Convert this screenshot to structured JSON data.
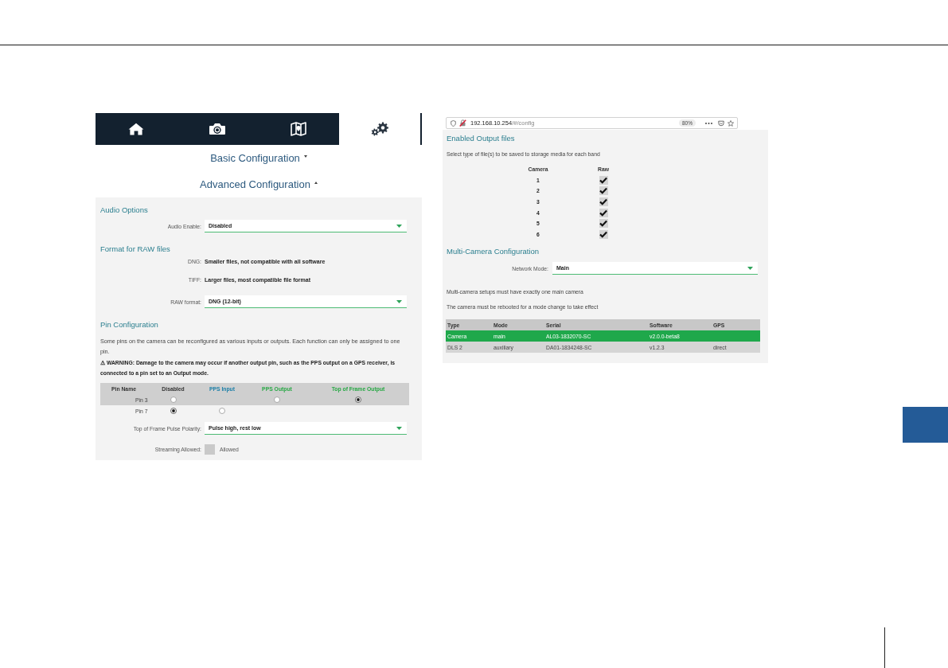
{
  "left_screen": {
    "nav_tabs": [
      {
        "kind": "home",
        "selected": false
      },
      {
        "kind": "camera",
        "selected": false
      },
      {
        "kind": "map",
        "selected": false
      },
      {
        "kind": "settings",
        "selected": true
      }
    ],
    "accordions": [
      {
        "title": "Basic Configuration",
        "expanded": false
      },
      {
        "title": "Advanced Configuration",
        "expanded": true
      }
    ],
    "sections": [
      {
        "heading": "Audio Options",
        "items": [
          {
            "kind": "select",
            "label": "Audio Enable:",
            "value": "Disabled"
          }
        ]
      },
      {
        "heading": "Format for RAW files",
        "items": [
          {
            "kind": "info",
            "label": "DNG:",
            "value": "Smaller files, not compatible with all software"
          },
          {
            "kind": "info",
            "label": "TIFF:",
            "value": "Larger files, most compatible file format"
          },
          {
            "kind": "select",
            "label": "RAW format:",
            "value": "DNG (12-bit)"
          }
        ]
      },
      {
        "heading": "Pin Configuration",
        "items": [
          {
            "kind": "paragraph",
            "text": "Some pins on the camera can be reconfigured as various inputs or outputs. Each function can only be assigned to one pin."
          },
          {
            "kind": "warning",
            "text": "⚠ WARNING: Damage to the camera may occur if another output pin, such as the PPS output on a GPS receiver, is connected to a pin set to an Output mode."
          },
          {
            "kind": "pin_table",
            "columns": [
              {
                "label": "Pin Name",
                "color": "#333333"
              },
              {
                "label": "Disabled",
                "color": "#333333"
              },
              {
                "label": "PPS Input",
                "color": "#1b7fa8"
              },
              {
                "label": "PPS Output",
                "color": "#27a844"
              },
              {
                "label": "Top of Frame Output",
                "color": "#27a844"
              }
            ],
            "rows": [
              {
                "name": "Pin 3",
                "cells": [
                  {
                    "kind": "radio",
                    "selected": false
                  },
                  {
                    "kind": "blank"
                  },
                  {
                    "kind": "radio",
                    "selected": false
                  },
                  {
                    "kind": "radio",
                    "selected": true
                  }
                ]
              },
              {
                "name": "Pin 7",
                "cells": [
                  {
                    "kind": "radio",
                    "selected": true
                  },
                  {
                    "kind": "radio",
                    "selected": false
                  },
                  {
                    "kind": "blank"
                  },
                  {
                    "kind": "blank"
                  }
                ]
              }
            ]
          },
          {
            "kind": "select",
            "label": "Top of Frame Pulse Polarity:",
            "value": "Pulse high, rest low"
          },
          {
            "kind": "checkbox",
            "label": "Streaming Allowed:",
            "option": "Allowed",
            "checked": false
          }
        ]
      }
    ]
  },
  "right_screen": {
    "address_bar": {
      "host": "192.168.10.254",
      "path": "/#/config",
      "zoom": "80%"
    },
    "output_files": {
      "heading": "Enabled Output files",
      "description": "Select type of file(s) to be saved to storage media for each band",
      "columns": [
        "Camera",
        "Raw"
      ],
      "rows": [
        {
          "camera": "1",
          "checked": true
        },
        {
          "camera": "2",
          "checked": true
        },
        {
          "camera": "3",
          "checked": true
        },
        {
          "camera": "4",
          "checked": true
        },
        {
          "camera": "5",
          "checked": true
        },
        {
          "camera": "6",
          "checked": true
        }
      ]
    },
    "multi_camera": {
      "heading": "Multi-Camera Configuration",
      "network_mode": {
        "label": "Network Mode:",
        "value": "Main"
      },
      "notes": [
        "Multi-camera setups must have exactly one main camera",
        "The camera must be rebooted for a mode change to take effect"
      ],
      "devices": {
        "columns": [
          "Type",
          "Mode",
          "Serial",
          "Software",
          "GPS"
        ],
        "rows": [
          {
            "selected": true,
            "type": "Camera",
            "mode": "main",
            "serial": "AL03-1832070-SC",
            "software": "v2.0.0-beta8"
          },
          {
            "selected": false,
            "type": "DLS 2",
            "mode": "auxiliary",
            "serial": "DA01-1834248-SC",
            "software": "v1.2.3",
            "gps": "direct"
          }
        ]
      }
    }
  }
}
